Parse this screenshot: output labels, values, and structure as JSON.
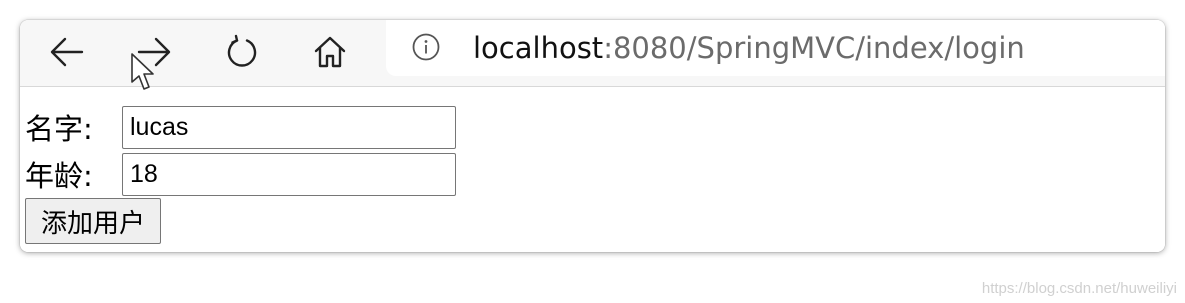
{
  "toolbar": {
    "back_icon": "back-arrow-icon",
    "forward_icon": "forward-arrow-icon",
    "reload_icon": "reload-icon",
    "home_icon": "home-icon",
    "info_icon": "info-icon"
  },
  "address": {
    "host": "localhost",
    "rest": ":8080/SpringMVC/index/login",
    "host_color": "#111111",
    "rest_color": "#6b6b6b"
  },
  "form": {
    "name_label": "名字:",
    "name_value": "lucas",
    "age_label": "年龄:",
    "age_value": "18",
    "submit_label": "添加用户"
  },
  "watermark": "https://blog.csdn.net/huweiliyi"
}
